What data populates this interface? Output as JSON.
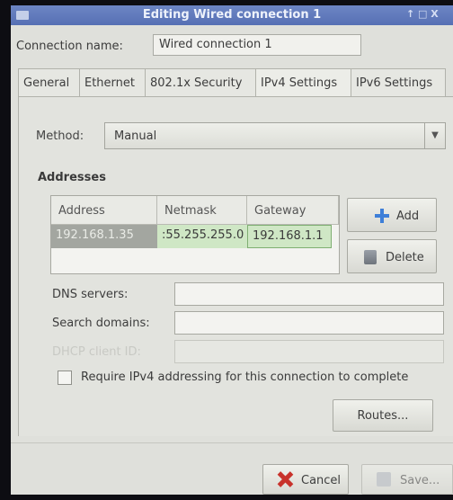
{
  "window": {
    "title": "Editing Wired connection 1",
    "controls": "↑ □ X"
  },
  "connection": {
    "label": "Connection name:",
    "value": "Wired connection 1"
  },
  "tabs": [
    {
      "label": "General"
    },
    {
      "label": "Ethernet"
    },
    {
      "label": "802.1x Security"
    },
    {
      "label": "IPv4 Settings"
    },
    {
      "label": "IPv6 Settings"
    }
  ],
  "method": {
    "label": "Method:",
    "value": "Manual"
  },
  "addresses": {
    "title": "Addresses",
    "columns": [
      "Address",
      "Netmask",
      "Gateway"
    ],
    "rows": [
      {
        "address": "192.168.1.35",
        "netmask": ":55.255.255.0",
        "gateway": "192.168.1.1"
      }
    ],
    "add_label": "Add",
    "delete_label": "Delete"
  },
  "fields": {
    "dns_label": "DNS servers:",
    "search_label": "Search domains:",
    "dhcp_label": "DHCP client ID:"
  },
  "require_ipv4_label": "Require IPv4 addressing for this connection to complete",
  "routes_label": "Routes...",
  "footer": {
    "cancel_label": "Cancel",
    "save_label": "Save..."
  }
}
